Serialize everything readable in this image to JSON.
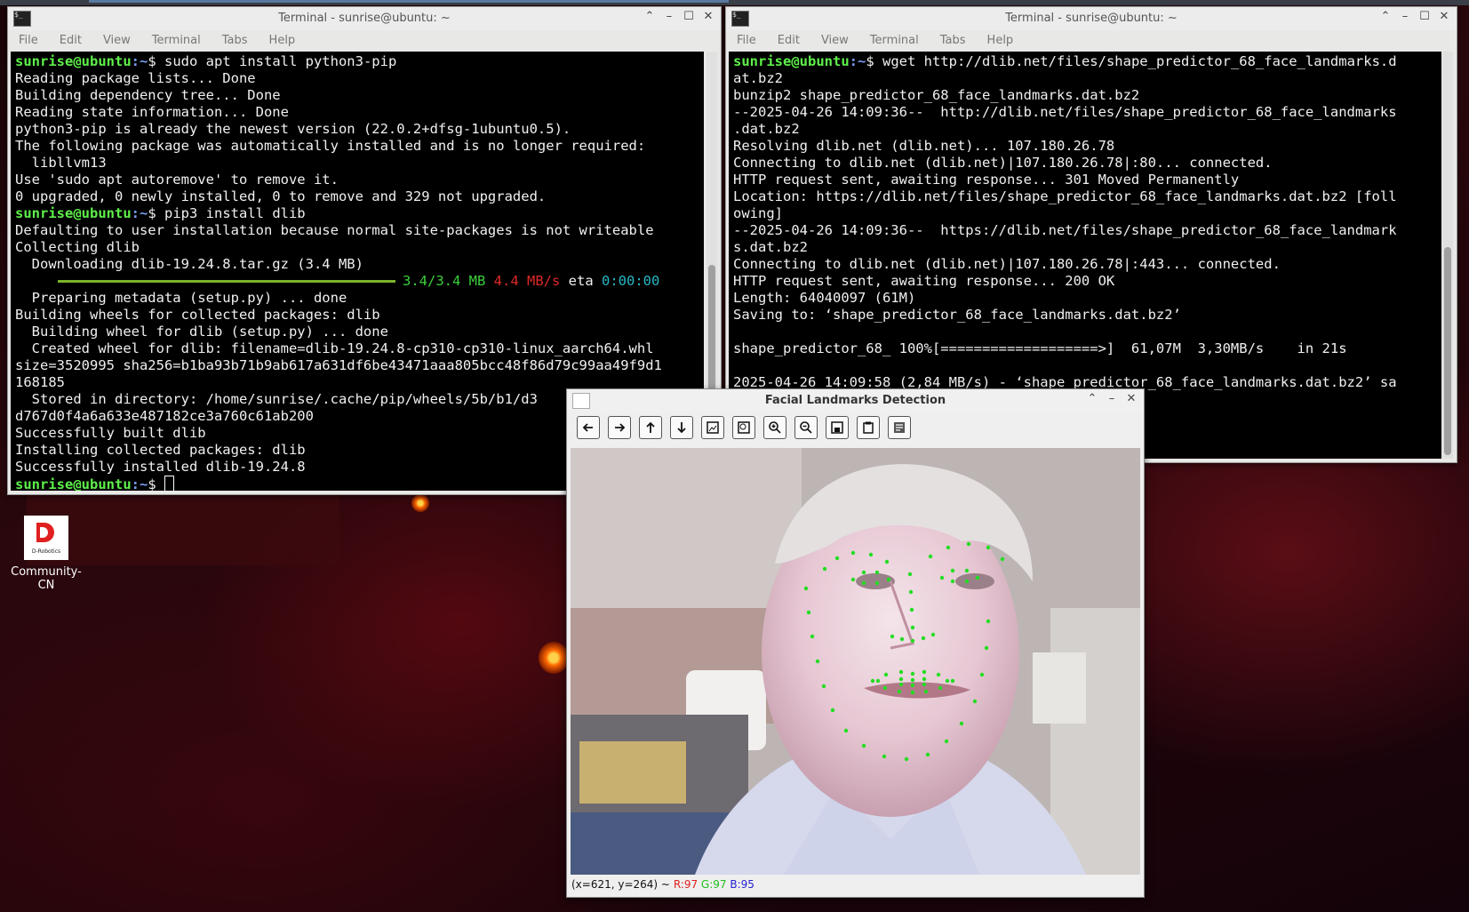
{
  "terminal_left": {
    "title": "Terminal - sunrise@ubuntu: ~",
    "menu": [
      "File",
      "Edit",
      "View",
      "Terminal",
      "Tabs",
      "Help"
    ],
    "prompt_user": "sunrise@ubuntu",
    "prompt_path": ":~",
    "prompt_symbol": "$",
    "lines": [
      {
        "type": "prompt",
        "cmd": " sudo apt install python3-pip"
      },
      {
        "type": "text",
        "text": "Reading package lists... Done"
      },
      {
        "type": "text",
        "text": "Building dependency tree... Done"
      },
      {
        "type": "text",
        "text": "Reading state information... Done"
      },
      {
        "type": "text",
        "text": "python3-pip is already the newest version (22.0.2+dfsg-1ubuntu0.5)."
      },
      {
        "type": "text",
        "text": "The following package was automatically installed and is no longer required:"
      },
      {
        "type": "text",
        "text": "  libllvm13"
      },
      {
        "type": "text",
        "text": "Use 'sudo apt autoremove' to remove it."
      },
      {
        "type": "text",
        "text": "0 upgraded, 0 newly installed, 0 to remove and 329 not upgraded."
      },
      {
        "type": "prompt",
        "cmd": " pip3 install dlib"
      },
      {
        "type": "text",
        "text": "Defaulting to user installation because normal site-packages is not writeable"
      },
      {
        "type": "text",
        "text": "Collecting dlib"
      },
      {
        "type": "text",
        "text": "  Downloading dlib-19.24.8.tar.gz (3.4 MB)"
      },
      {
        "type": "progress",
        "done": "3.4/3.4 MB",
        "speed": "4.4 MB/s",
        "eta_label": "eta",
        "eta": "0:00:00",
        "fraction": 1.0
      },
      {
        "type": "text",
        "text": "  Preparing metadata (setup.py) ... done"
      },
      {
        "type": "text",
        "text": "Building wheels for collected packages: dlib"
      },
      {
        "type": "text",
        "text": "  Building wheel for dlib (setup.py) ... done"
      },
      {
        "type": "text",
        "text": "  Created wheel for dlib: filename=dlib-19.24.8-cp310-cp310-linux_aarch64.whl"
      },
      {
        "type": "text",
        "text": "size=3520995 sha256=b1ba93b71b9ab617a631df6be43471aaa805bcc48f86d79c99aa49f9d1"
      },
      {
        "type": "text",
        "text": "168185"
      },
      {
        "type": "text",
        "text": "  Stored in directory: /home/sunrise/.cache/pip/wheels/5b/b1/d3"
      },
      {
        "type": "text",
        "text": "d767d0f4a6a633e487182ce3a760c61ab200"
      },
      {
        "type": "text",
        "text": "Successfully built dlib"
      },
      {
        "type": "text",
        "text": "Installing collected packages: dlib"
      },
      {
        "type": "text",
        "text": "Successfully installed dlib-19.24.8"
      },
      {
        "type": "prompt",
        "cmd": " ",
        "cursor": true
      }
    ]
  },
  "terminal_right": {
    "title": "Terminal - sunrise@ubuntu: ~",
    "menu": [
      "File",
      "Edit",
      "View",
      "Terminal",
      "Tabs",
      "Help"
    ],
    "lines": [
      {
        "type": "prompt",
        "cmd": " wget http://dlib.net/files/shape_predictor_68_face_landmarks.d"
      },
      {
        "type": "text",
        "text": "at.bz2"
      },
      {
        "type": "text",
        "text": "bunzip2 shape_predictor_68_face_landmarks.dat.bz2"
      },
      {
        "type": "text",
        "text": "--2025-04-26 14:09:36--  http://dlib.net/files/shape_predictor_68_face_landmarks"
      },
      {
        "type": "text",
        "text": ".dat.bz2"
      },
      {
        "type": "text",
        "text": "Resolving dlib.net (dlib.net)... 107.180.26.78"
      },
      {
        "type": "text",
        "text": "Connecting to dlib.net (dlib.net)|107.180.26.78|:80... connected."
      },
      {
        "type": "text",
        "text": "HTTP request sent, awaiting response... 301 Moved Permanently"
      },
      {
        "type": "text",
        "text": "Location: https://dlib.net/files/shape_predictor_68_face_landmarks.dat.bz2 [foll"
      },
      {
        "type": "text",
        "text": "owing]"
      },
      {
        "type": "text",
        "text": "--2025-04-26 14:09:36--  https://dlib.net/files/shape_predictor_68_face_landmark"
      },
      {
        "type": "text",
        "text": "s.dat.bz2"
      },
      {
        "type": "text",
        "text": "Connecting to dlib.net (dlib.net)|107.180.26.78|:443... connected."
      },
      {
        "type": "text",
        "text": "HTTP request sent, awaiting response... 200 OK"
      },
      {
        "type": "text",
        "text": "Length: 64040097 (61M)"
      },
      {
        "type": "text",
        "text": "Saving to: ‘shape_predictor_68_face_landmarks.dat.bz2’"
      },
      {
        "type": "text",
        "text": ""
      },
      {
        "type": "text",
        "text": "shape_predictor_68_ 100%[===================>]  61,07M  3,30MB/s    in 21s"
      },
      {
        "type": "text",
        "text": ""
      },
      {
        "type": "text",
        "text": "2025-04-26 14:09:58 (2,84 MB/s) - ‘shape_predictor_68_face_landmarks.dat.bz2’ sa"
      }
    ]
  },
  "desktop_icon": {
    "label": "Community-CN",
    "logo_text": "D-Robotics"
  },
  "cv_window": {
    "title": "Facial Landmarks Detection",
    "toolbar": [
      "pan-left-icon",
      "pan-right-icon",
      "pan-up-icon",
      "pan-down-icon",
      "zoom-fit-icon",
      "zoom-original-icon",
      "zoom-in-icon",
      "zoom-out-icon",
      "save-icon",
      "copy-clipboard-icon",
      "properties-icon"
    ],
    "status": {
      "coords": "(x=621, y=264) ~",
      "r": "R:97",
      "g": "G:97",
      "b": "B:95"
    },
    "landmark_color": "#22dd22"
  }
}
